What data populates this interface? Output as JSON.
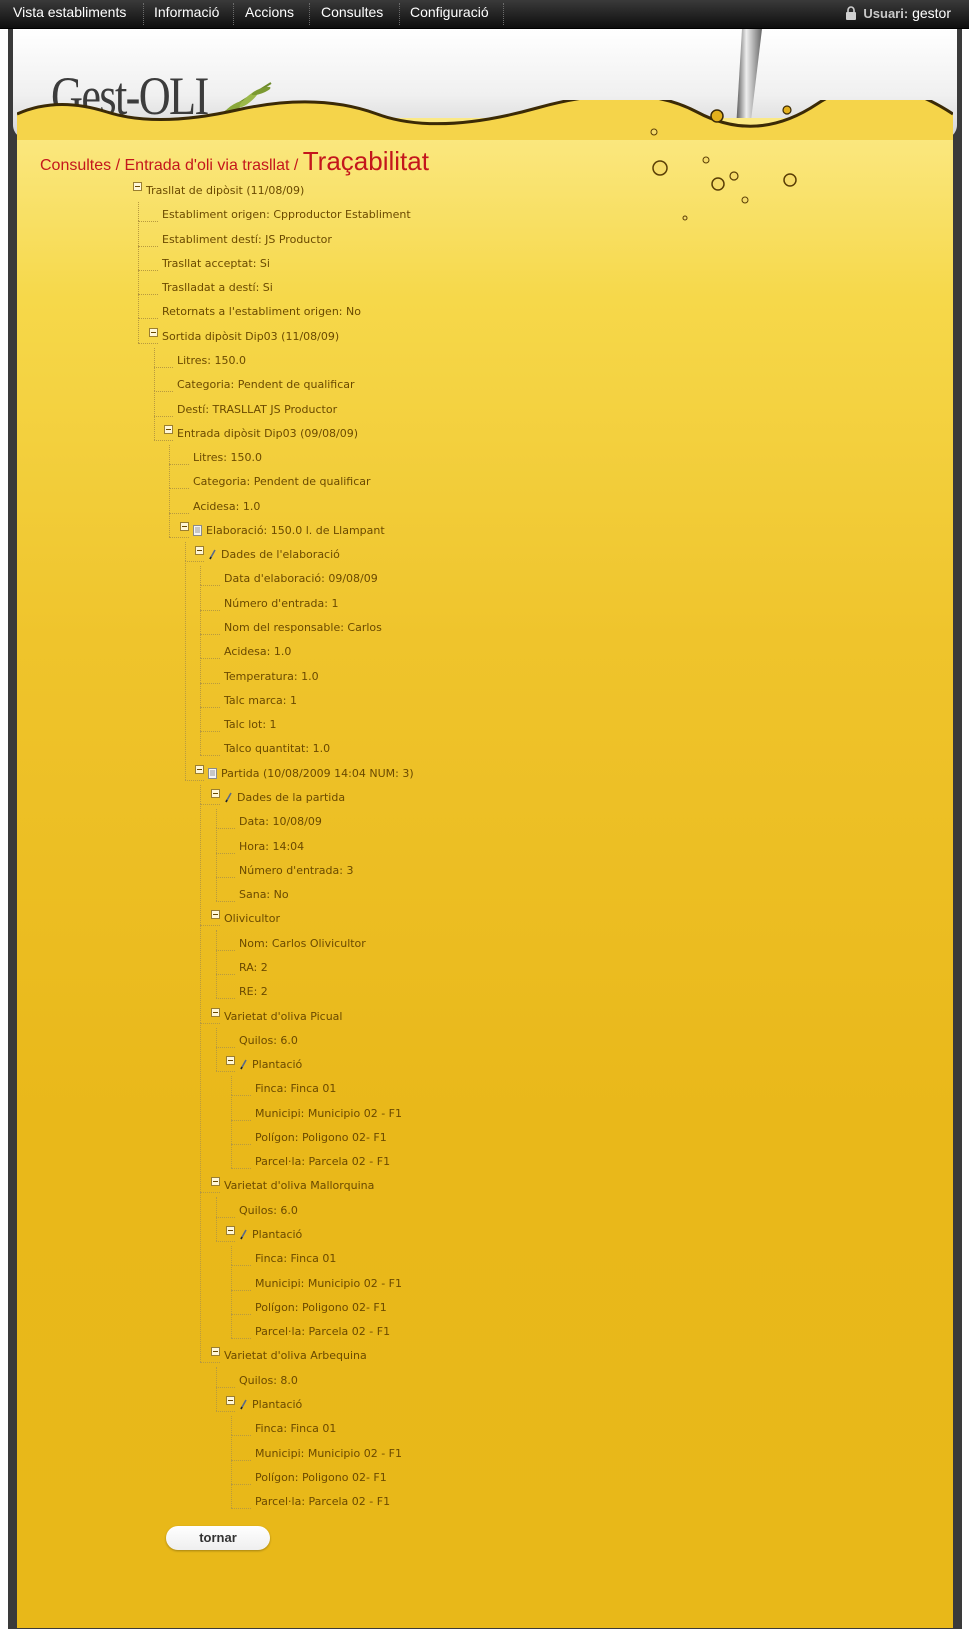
{
  "nav": {
    "items": [
      "Vista establiments",
      "Informació",
      "Accions",
      "Consultes",
      "Configuració"
    ],
    "user_label": "Usuari:",
    "user_name": "gestor"
  },
  "header": {
    "logo": "Gest-OLI"
  },
  "breadcrumb": {
    "crumb1": "Consultes",
    "sep1": " / ",
    "crumb2": "Entrada d'oli via trasllat",
    "sep2": " / ",
    "current": "Traçabilitat"
  },
  "tree": [
    {
      "text": "Trasllat de dipòsit (11/08/09)",
      "level": 0,
      "toggle": true,
      "icon": ""
    },
    {
      "text": "Establiment origen: Cpproductor Establiment",
      "level": 1,
      "toggle": false,
      "icon": ""
    },
    {
      "text": "Establiment destí: JS Productor",
      "level": 1,
      "toggle": false,
      "icon": ""
    },
    {
      "text": "Trasllat acceptat: Si",
      "level": 1,
      "toggle": false,
      "icon": ""
    },
    {
      "text": "Traslladat a destí: Si",
      "level": 1,
      "toggle": false,
      "icon": ""
    },
    {
      "text": "Retornats a l'establiment origen: No",
      "level": 1,
      "toggle": false,
      "icon": ""
    },
    {
      "text": "Sortida dipòsit Dip03 (11/08/09)",
      "level": 1,
      "toggle": true,
      "icon": ""
    },
    {
      "text": "Litres: 150.0",
      "level": 2,
      "toggle": false,
      "icon": ""
    },
    {
      "text": "Categoria: Pendent de qualificar",
      "level": 2,
      "toggle": false,
      "icon": ""
    },
    {
      "text": "Destí: TRASLLAT JS Productor",
      "level": 2,
      "toggle": false,
      "icon": ""
    },
    {
      "text": "Entrada dipòsit Dip03 (09/08/09)",
      "level": 2,
      "toggle": true,
      "icon": ""
    },
    {
      "text": "Litres: 150.0",
      "level": 3,
      "toggle": false,
      "icon": ""
    },
    {
      "text": "Categoria: Pendent de qualificar",
      "level": 3,
      "toggle": false,
      "icon": ""
    },
    {
      "text": "Acidesa: 1.0",
      "level": 3,
      "toggle": false,
      "icon": ""
    },
    {
      "text": "Elaboració: 150.0 l. de Llampant",
      "level": 3,
      "toggle": true,
      "icon": "doc-icon"
    },
    {
      "text": "Dades de l'elaboració",
      "level": 4,
      "toggle": true,
      "icon": "pen-icon"
    },
    {
      "text": "Data d'elaboració: 09/08/09",
      "level": 5,
      "toggle": false,
      "icon": ""
    },
    {
      "text": "Número d'entrada: 1",
      "level": 5,
      "toggle": false,
      "icon": ""
    },
    {
      "text": "Nom del responsable: Carlos",
      "level": 5,
      "toggle": false,
      "icon": ""
    },
    {
      "text": "Acidesa: 1.0",
      "level": 5,
      "toggle": false,
      "icon": ""
    },
    {
      "text": "Temperatura: 1.0",
      "level": 5,
      "toggle": false,
      "icon": ""
    },
    {
      "text": "Talc marca: 1",
      "level": 5,
      "toggle": false,
      "icon": ""
    },
    {
      "text": "Talc lot: 1",
      "level": 5,
      "toggle": false,
      "icon": ""
    },
    {
      "text": "Talco quantitat: 1.0",
      "level": 5,
      "toggle": false,
      "icon": ""
    },
    {
      "text": "Partida (10/08/2009 14:04 NUM: 3)",
      "level": 4,
      "toggle": true,
      "icon": "doc-icon"
    },
    {
      "text": "Dades de la partida",
      "level": 5,
      "toggle": true,
      "icon": "pen-icon"
    },
    {
      "text": "Data: 10/08/09",
      "level": 6,
      "toggle": false,
      "icon": ""
    },
    {
      "text": "Hora: 14:04",
      "level": 6,
      "toggle": false,
      "icon": ""
    },
    {
      "text": "Número d'entrada: 3",
      "level": 6,
      "toggle": false,
      "icon": ""
    },
    {
      "text": "Sana: No",
      "level": 6,
      "toggle": false,
      "icon": ""
    },
    {
      "text": "Olivicultor",
      "level": 5,
      "toggle": true,
      "icon": ""
    },
    {
      "text": "Nom: Carlos Olivicultor",
      "level": 6,
      "toggle": false,
      "icon": ""
    },
    {
      "text": "RA: 2",
      "level": 6,
      "toggle": false,
      "icon": ""
    },
    {
      "text": "RE: 2",
      "level": 6,
      "toggle": false,
      "icon": ""
    },
    {
      "text": "Varietat d'oliva Picual",
      "level": 5,
      "toggle": true,
      "icon": ""
    },
    {
      "text": "Quilos: 6.0",
      "level": 6,
      "toggle": false,
      "icon": ""
    },
    {
      "text": "Plantació",
      "level": 6,
      "toggle": true,
      "icon": "pen-icon"
    },
    {
      "text": "Finca: Finca 01",
      "level": 7,
      "toggle": false,
      "icon": ""
    },
    {
      "text": "Municipi: Municipio 02 - F1",
      "level": 7,
      "toggle": false,
      "icon": ""
    },
    {
      "text": "Polígon: Poligono 02- F1",
      "level": 7,
      "toggle": false,
      "icon": ""
    },
    {
      "text": "Parcel·la: Parcela 02 - F1",
      "level": 7,
      "toggle": false,
      "icon": ""
    },
    {
      "text": "Varietat d'oliva Mallorquina",
      "level": 5,
      "toggle": true,
      "icon": ""
    },
    {
      "text": "Quilos: 6.0",
      "level": 6,
      "toggle": false,
      "icon": ""
    },
    {
      "text": "Plantació",
      "level": 6,
      "toggle": true,
      "icon": "pen-icon"
    },
    {
      "text": "Finca: Finca 01",
      "level": 7,
      "toggle": false,
      "icon": ""
    },
    {
      "text": "Municipi: Municipio 02 - F1",
      "level": 7,
      "toggle": false,
      "icon": ""
    },
    {
      "text": "Polígon: Poligono 02- F1",
      "level": 7,
      "toggle": false,
      "icon": ""
    },
    {
      "text": "Parcel·la: Parcela 02 - F1",
      "level": 7,
      "toggle": false,
      "icon": ""
    },
    {
      "text": "Varietat d'oliva Arbequina",
      "level": 5,
      "toggle": true,
      "icon": ""
    },
    {
      "text": "Quilos: 8.0",
      "level": 6,
      "toggle": false,
      "icon": ""
    },
    {
      "text": "Plantació",
      "level": 6,
      "toggle": true,
      "icon": "pen-icon"
    },
    {
      "text": "Finca: Finca 01",
      "level": 7,
      "toggle": false,
      "icon": ""
    },
    {
      "text": "Municipi: Municipio 02 - F1",
      "level": 7,
      "toggle": false,
      "icon": ""
    },
    {
      "text": "Polígon: Poligono 02- F1",
      "level": 7,
      "toggle": false,
      "icon": ""
    },
    {
      "text": "Parcel·la: Parcela 02 - F1",
      "level": 7,
      "toggle": false,
      "icon": ""
    }
  ],
  "actions": {
    "back_label": "tornar"
  },
  "colors": {
    "link": "#c4161c",
    "tree_text": "#6b4a00",
    "oil": "#efc42c"
  }
}
